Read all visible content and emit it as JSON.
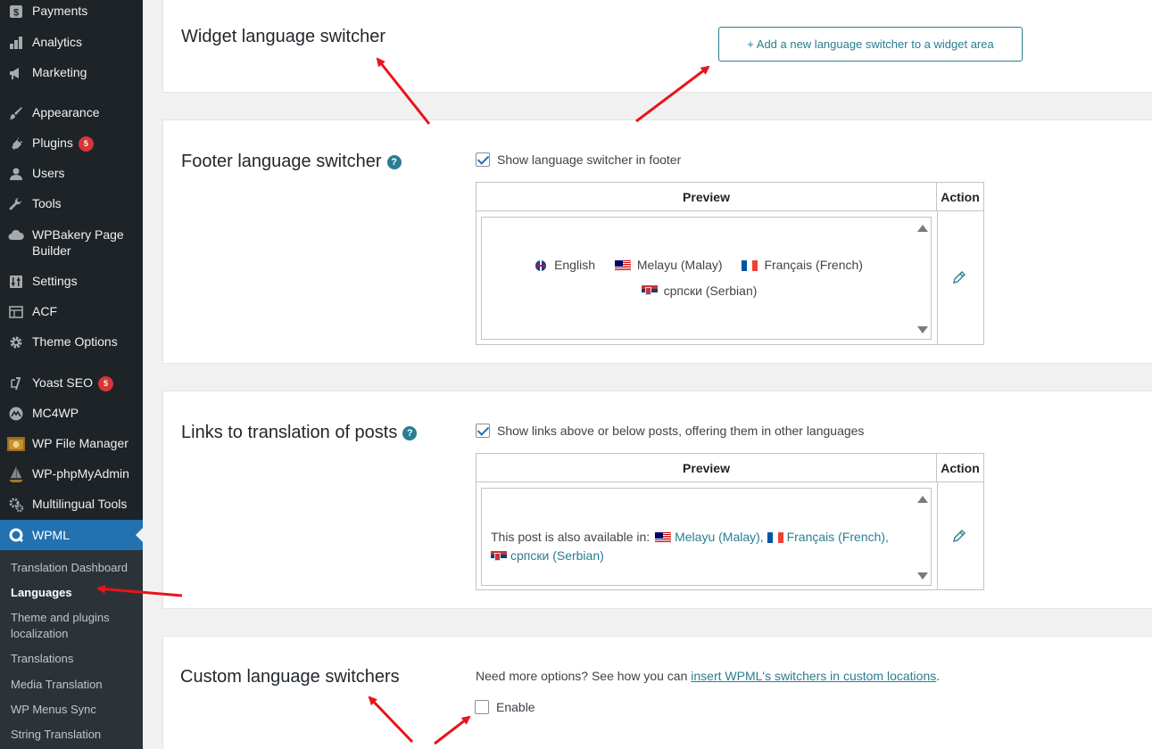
{
  "sidebar": {
    "items": [
      {
        "label": "Payments",
        "icon": "dollar-icon"
      },
      {
        "label": "Analytics",
        "icon": "bar-chart-icon"
      },
      {
        "label": "Marketing",
        "icon": "megaphone-icon"
      },
      {
        "label": "Appearance",
        "icon": "paintbrush-icon"
      },
      {
        "label": "Plugins",
        "icon": "plug-icon",
        "badge": "5"
      },
      {
        "label": "Users",
        "icon": "user-icon"
      },
      {
        "label": "Tools",
        "icon": "wrench-icon"
      },
      {
        "label": "WPBakery Page Builder",
        "icon": "cloud-icon"
      },
      {
        "label": "Settings",
        "icon": "sliders-icon"
      },
      {
        "label": "ACF",
        "icon": "table-icon"
      },
      {
        "label": "Theme Options",
        "icon": "gear-icon"
      },
      {
        "label": "Yoast SEO",
        "icon": "yoast-icon",
        "badge": "5"
      },
      {
        "label": "MC4WP",
        "icon": "mailchimp-icon"
      },
      {
        "label": "WP File Manager",
        "icon": "folder-icon"
      },
      {
        "label": "WP-phpMyAdmin",
        "icon": "sailboat-icon"
      },
      {
        "label": "Multilingual Tools",
        "icon": "gears-icon"
      },
      {
        "label": "WPML",
        "icon": "wpml-icon"
      }
    ],
    "submenu": [
      {
        "label": "Translation Dashboard"
      },
      {
        "label": "Languages"
      },
      {
        "label": "Theme and plugins localization"
      },
      {
        "label": "Translations"
      },
      {
        "label": "Media Translation"
      },
      {
        "label": "WP Menus Sync"
      },
      {
        "label": "String Translation"
      }
    ]
  },
  "widget": {
    "title": "Widget language switcher",
    "add_button": "+ Add a new language switcher to a widget area"
  },
  "footer": {
    "title": "Footer language switcher",
    "help": "?",
    "checkbox_label": "Show language switcher in footer",
    "checked": true,
    "preview_header": "Preview",
    "action_header": "Action",
    "languages": [
      "English",
      "Melayu (Malay)",
      "Français (French)",
      "српски (Serbian)"
    ]
  },
  "links": {
    "title": "Links to translation of posts",
    "help": "?",
    "checkbox_label": "Show links above or below posts, offering them in other languages",
    "checked": true,
    "preview_header": "Preview",
    "action_header": "Action",
    "intro": "This post is also available in:",
    "languages": [
      "Melayu (Malay),",
      "Français (French),",
      "српски (Serbian)"
    ]
  },
  "custom": {
    "title": "Custom language switchers",
    "note_before": "Need more options? See how you can ",
    "note_link": "insert WPML's switchers in custom locations",
    "note_after": ".",
    "enable_label": "Enable",
    "checked": false
  },
  "colors": {
    "sidebar_bg": "#1d2327",
    "active_bg": "#2271b1",
    "accent": "#2a7d92",
    "annotation_arrow": "#e8141b"
  }
}
